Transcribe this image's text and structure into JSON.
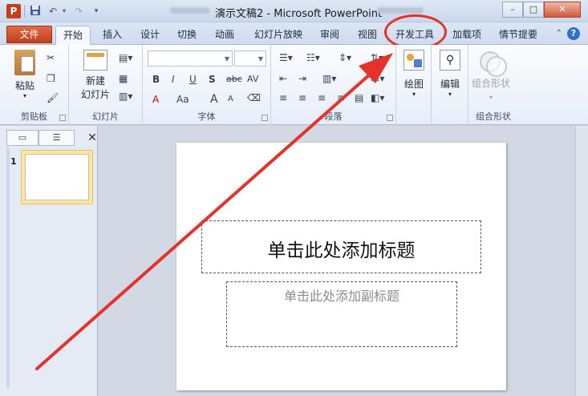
{
  "app": {
    "icon_letter": "P",
    "title": "演示文稿2 - Microsoft PowerPoint"
  },
  "quick_access": {
    "save_icon": "save-icon",
    "undo_icon": "undo-icon",
    "redo_icon": "redo-icon",
    "customize_icon": "customize-qat-icon"
  },
  "window_controls": {
    "minimize": "–",
    "restore": "□",
    "close": "✕"
  },
  "tabs": [
    {
      "label": "文件"
    },
    {
      "label": "开始"
    },
    {
      "label": "插入"
    },
    {
      "label": "设计"
    },
    {
      "label": "切换"
    },
    {
      "label": "动画"
    },
    {
      "label": "幻灯片放映"
    },
    {
      "label": "审阅"
    },
    {
      "label": "视图"
    },
    {
      "label": "开发工具"
    },
    {
      "label": "加载项"
    },
    {
      "label": "情节提要"
    }
  ],
  "help_label": "?",
  "ribbon": {
    "clipboard": {
      "label": "剪贴板",
      "paste": "粘贴"
    },
    "slides": {
      "label": "幻灯片",
      "new_slide_1": "新建",
      "new_slide_2": "幻灯片"
    },
    "font": {
      "label": "字体",
      "bold": "B",
      "italic": "I",
      "underline": "U",
      "shadow": "S",
      "strike": "abc",
      "spacing": "AV",
      "font_color": "A",
      "change_case": "Aa",
      "grow": "A",
      "shrink": "A"
    },
    "paragraph": {
      "label": "段落"
    },
    "drawing": {
      "label": "绘图"
    },
    "editing": {
      "label": "编辑"
    },
    "shape_combine": {
      "label": "组合形状",
      "button": "组合形状"
    }
  },
  "slide_panel": {
    "slide_number": "1"
  },
  "slide": {
    "title_placeholder": "单击此处添加标题",
    "subtitle_placeholder": "单击此处添加副标题"
  },
  "colors": {
    "file_tab": "#c9502c",
    "annotation_red": "#e5322b",
    "accent_blue": "#2f6fd1"
  }
}
